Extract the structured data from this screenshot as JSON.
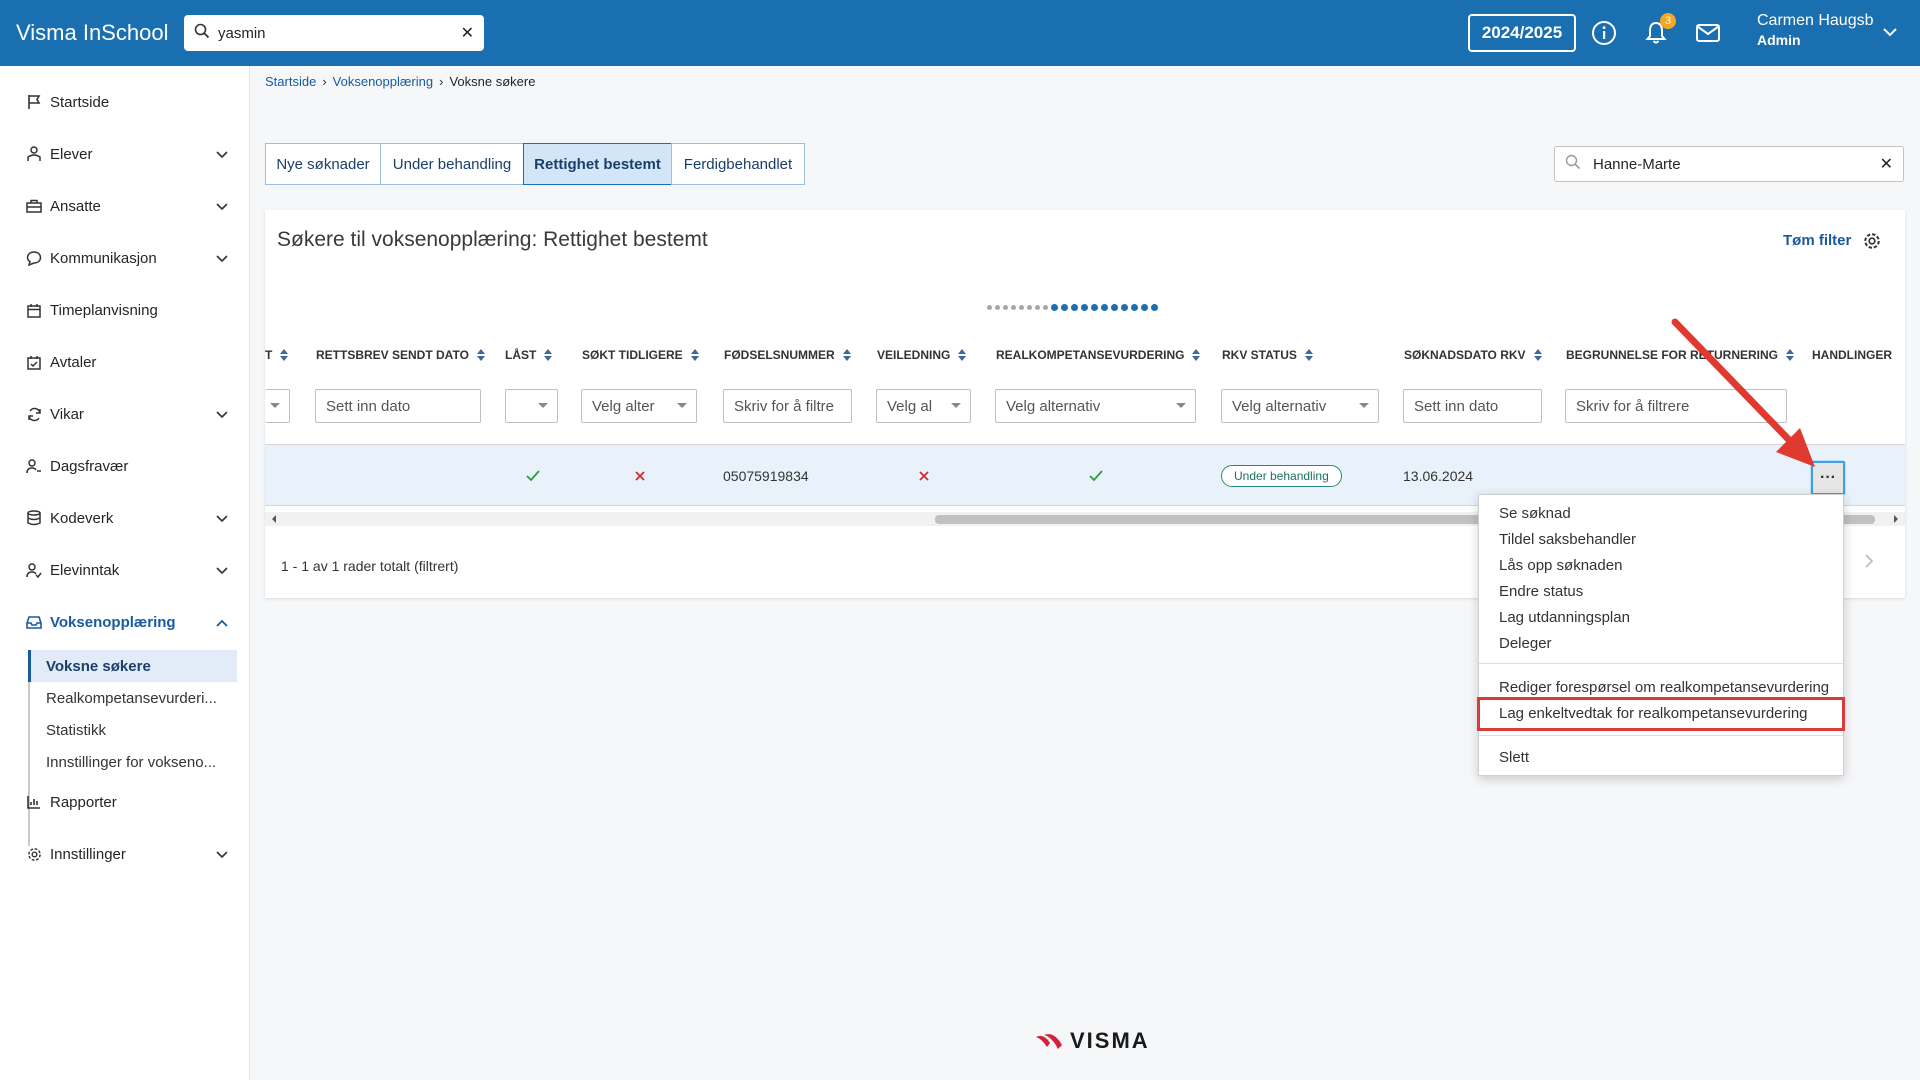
{
  "app": {
    "title": "Visma InSchool"
  },
  "header": {
    "search_value": "yasmin",
    "school_year": "2024/2025",
    "notification_count": "3",
    "user_name": "Carmen Haugsb",
    "user_role": "Admin"
  },
  "sidebar": {
    "items": [
      {
        "label": "Startside",
        "icon": "flag-icon"
      },
      {
        "label": "Elever",
        "icon": "students-icon"
      },
      {
        "label": "Ansatte",
        "icon": "briefcase-icon"
      },
      {
        "label": "Kommunikasjon",
        "icon": "chat-icon"
      },
      {
        "label": "Timeplanvisning",
        "icon": "calendar-icon"
      },
      {
        "label": "Avtaler",
        "icon": "calendar-check-icon"
      },
      {
        "label": "Vikar",
        "icon": "refresh-icon"
      },
      {
        "label": "Dagsfravær",
        "icon": "user-absence-icon"
      },
      {
        "label": "Kodeverk",
        "icon": "database-icon"
      },
      {
        "label": "Elevinntak",
        "icon": "user-intake-icon"
      },
      {
        "label": "Voksenopplæring",
        "icon": "inbox-icon"
      },
      {
        "label": "Rapporter",
        "icon": "bar-chart-icon"
      },
      {
        "label": "Innstillinger",
        "icon": "gear-icon"
      }
    ],
    "sub_items": [
      {
        "label": "Voksne søkere"
      },
      {
        "label": "Realkompetansevurderi..."
      },
      {
        "label": "Statistikk"
      },
      {
        "label": "Innstillinger for vokseno..."
      }
    ]
  },
  "breadcrumb": [
    "Startside",
    "Voksenopplæring",
    "Voksne søkere"
  ],
  "tabs": [
    "Nye søknader",
    "Under behandling",
    "Rettighet bestemt",
    "Ferdigbehandlet"
  ],
  "search_filter": {
    "value": "Hanne-Marte"
  },
  "card": {
    "title": "Søkere til voksenopplæring: Rettighet bestemt",
    "clear_filter": "Tøm filter"
  },
  "table": {
    "columns": [
      {
        "label": "T"
      },
      {
        "label": "RETTSBREV SENDT DATO"
      },
      {
        "label": "LÅST"
      },
      {
        "label": "SØKT TIDLIGERE"
      },
      {
        "label": "FØDSELSNUMMER"
      },
      {
        "label": "VEILEDNING"
      },
      {
        "label": "REALKOMPETANSEVURDERING"
      },
      {
        "label": "RKV STATUS"
      },
      {
        "label": "SØKNADSDATO RKV"
      },
      {
        "label": "BEGRUNNELSE FOR RETURNERING"
      },
      {
        "label": "HANDLINGER"
      }
    ],
    "filters": {
      "rettsbrev": "Sett inn dato",
      "sokt": "Velg alter",
      "fodsel": "Skriv for å filtre",
      "veiledning": "Velg al",
      "realkomp": "Velg alternativ",
      "rkv_status": "Velg alternativ",
      "soknadsdato": "Sett inn dato",
      "begrunnelse": "Skriv for å filtrere"
    },
    "row": {
      "fodselsnummer": "05075919834",
      "rkv_status": "Under behandling",
      "soknadsdato": "13.06.2024"
    },
    "pager": "1 - 1 av 1 rader totalt (filtrert)"
  },
  "context_menu": {
    "items": [
      "Se søknad",
      "Tildel saksbehandler",
      "Lås opp søknaden",
      "Endre status",
      "Lag utdanningsplan",
      "Deleger",
      "Rediger forespørsel om realkompetansevurdering",
      "Lag enkeltvedtak for realkompetansevurdering",
      "Slett"
    ]
  },
  "footer": {
    "logo": "VISMA"
  },
  "colors": {
    "primary": "#1a6fb0",
    "annotation": "#d93a3a",
    "check": "#2e9a3a",
    "cross": "#d42a2a"
  }
}
